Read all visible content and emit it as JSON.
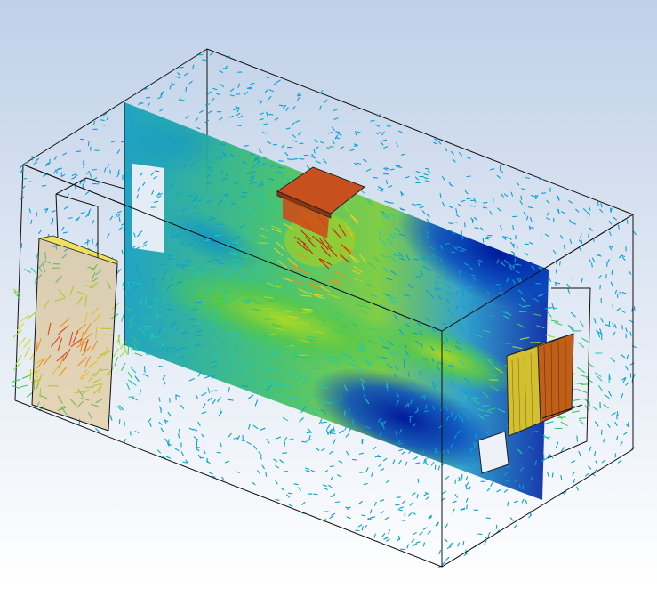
{
  "viewport": {
    "background_top": "#bfd0e8",
    "background_bottom": "#ffffff"
  },
  "colormap": [
    "#00129a",
    "#0050c8",
    "#0aa0d2",
    "#20c8b4",
    "#3cc864",
    "#a0dc28",
    "#e6d21e",
    "#f08c14",
    "#d21e0a"
  ],
  "room": {
    "edge_color": "#111111"
  },
  "plane": {
    "fill": "#14a5c8"
  }
}
